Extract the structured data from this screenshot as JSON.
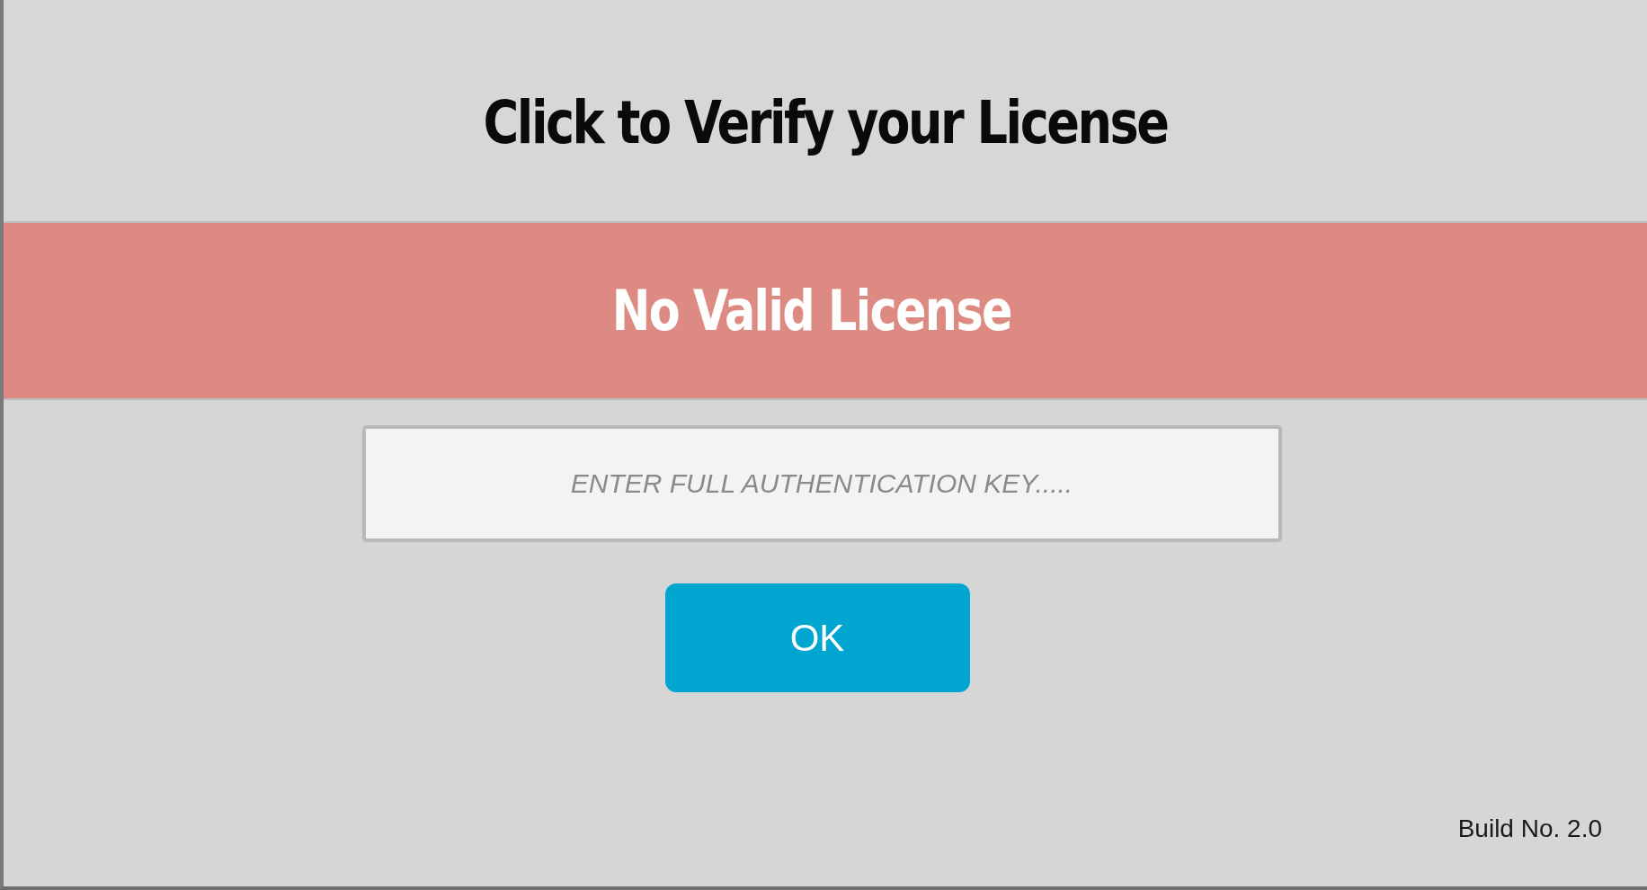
{
  "title": "Click to Verify your License",
  "license_status": {
    "text": "No Valid License",
    "valid": false
  },
  "key_field": {
    "placeholder": "ENTER FULL AUTHENTICATION KEY....."
  },
  "buttons": [
    "OK"
  ],
  "build": "Build No. 2.0"
}
